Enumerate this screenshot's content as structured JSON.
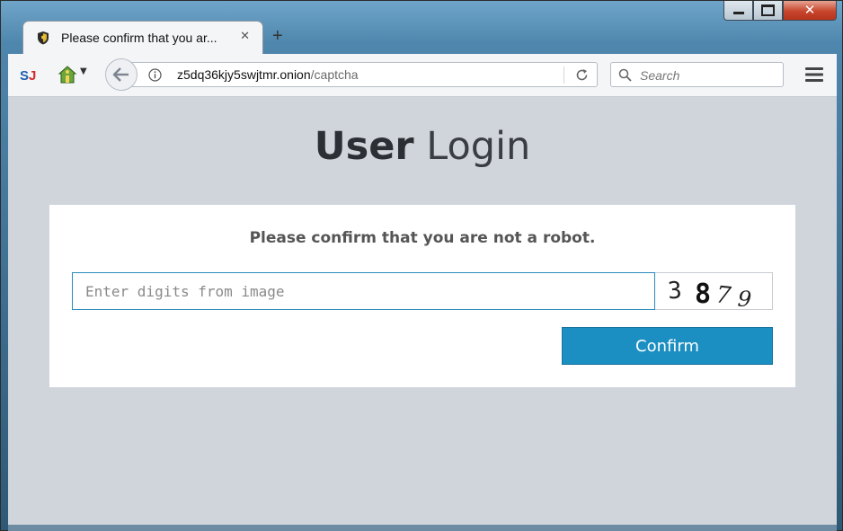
{
  "browser": {
    "tab": {
      "title": "Please confirm that you ar..."
    },
    "address": {
      "host": "z5dq36kjy5swjtmr.onion",
      "path": "/captcha"
    },
    "search": {
      "placeholder": "Search"
    },
    "icons": {
      "extension_1": "sj-extension-icon",
      "extension_2": "green-house-icon",
      "back": "arrow-left-icon",
      "info": "info-icon",
      "reload": "reload-icon",
      "search": "magnifier-icon",
      "menu": "hamburger-icon",
      "favicon": "shield-favicon-icon",
      "new_tab": "plus-icon",
      "tab_close": "close-icon"
    }
  },
  "page": {
    "title_bold": "User",
    "title_light": "Login",
    "prompt": "Please confirm that you are not a robot.",
    "captcha_placeholder": "Enter digits from image",
    "captcha_digits": [
      "3",
      "8",
      "7",
      "9"
    ],
    "confirm_label": "Confirm"
  },
  "colors": {
    "content_bg": "#d0d5dc",
    "accent": "#1b8ec2",
    "input_border": "#2a8bbd"
  }
}
